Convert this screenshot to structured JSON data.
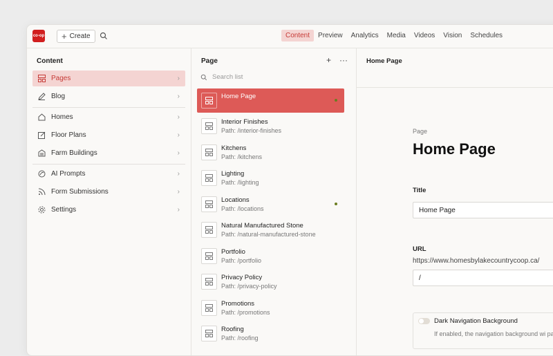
{
  "topbar": {
    "logo_text": "co-op",
    "create_label": "Create",
    "tabs": [
      {
        "label": "Content",
        "active": true
      },
      {
        "label": "Preview",
        "active": false
      },
      {
        "label": "Analytics",
        "active": false
      },
      {
        "label": "Media",
        "active": false
      },
      {
        "label": "Videos",
        "active": false
      },
      {
        "label": "Vision",
        "active": false
      },
      {
        "label": "Schedules",
        "active": false
      }
    ]
  },
  "sidebar": {
    "title": "Content",
    "items": [
      {
        "label": "Pages",
        "icon": "page-layout-icon",
        "active": true
      },
      {
        "label": "Blog",
        "icon": "pencil-icon",
        "active": false
      },
      {
        "label": "Homes",
        "icon": "home-icon",
        "active": false
      },
      {
        "label": "Floor Plans",
        "icon": "edit-square-icon",
        "active": false
      },
      {
        "label": "Farm Buildings",
        "icon": "barn-icon",
        "active": false
      },
      {
        "label": "AI Prompts",
        "icon": "ai-icon",
        "active": false
      },
      {
        "label": "Form Submissions",
        "icon": "rss-icon",
        "active": false
      },
      {
        "label": "Settings",
        "icon": "gear-icon",
        "active": false
      }
    ]
  },
  "pagelist": {
    "title": "Page",
    "search_placeholder": "Search list",
    "items": [
      {
        "title": "Home Page",
        "path": "",
        "active": true,
        "dot": true
      },
      {
        "title": "Interior Finishes",
        "path": "Path: /interior-finishes",
        "active": false,
        "dot": false
      },
      {
        "title": "Kitchens",
        "path": "Path: /kitchens",
        "active": false,
        "dot": false
      },
      {
        "title": "Lighting",
        "path": "Path: /lighting",
        "active": false,
        "dot": false
      },
      {
        "title": "Locations",
        "path": "Path: /locations",
        "active": false,
        "dot": true
      },
      {
        "title": "Natural Manufactured Stone",
        "path": "Path: /natural-manufactured-stone",
        "active": false,
        "dot": false
      },
      {
        "title": "Portfolio",
        "path": "Path: /portfolio",
        "active": false,
        "dot": false
      },
      {
        "title": "Privacy Policy",
        "path": "Path: /privacy-policy",
        "active": false,
        "dot": false
      },
      {
        "title": "Promotions",
        "path": "Path: /promotions",
        "active": false,
        "dot": false
      },
      {
        "title": "Roofing",
        "path": "Path: /roofing",
        "active": false,
        "dot": false
      }
    ]
  },
  "editor": {
    "header": "Home Page",
    "kicker": "Page",
    "title": "Home Page",
    "title_label": "Title",
    "title_value": "Home Page",
    "url_label": "URL",
    "url_prefix": "https://www.homesbylakecountrycoop.ca/",
    "url_value": "/",
    "toggle_label": "Dark Navigation Background",
    "toggle_help": "If enabled, the navigation background wi page."
  },
  "colors": {
    "accent": "#dd5a57",
    "active_bg": "#f4d4d2",
    "active_text": "#c63a36",
    "status_dot": "#6b7d20"
  }
}
